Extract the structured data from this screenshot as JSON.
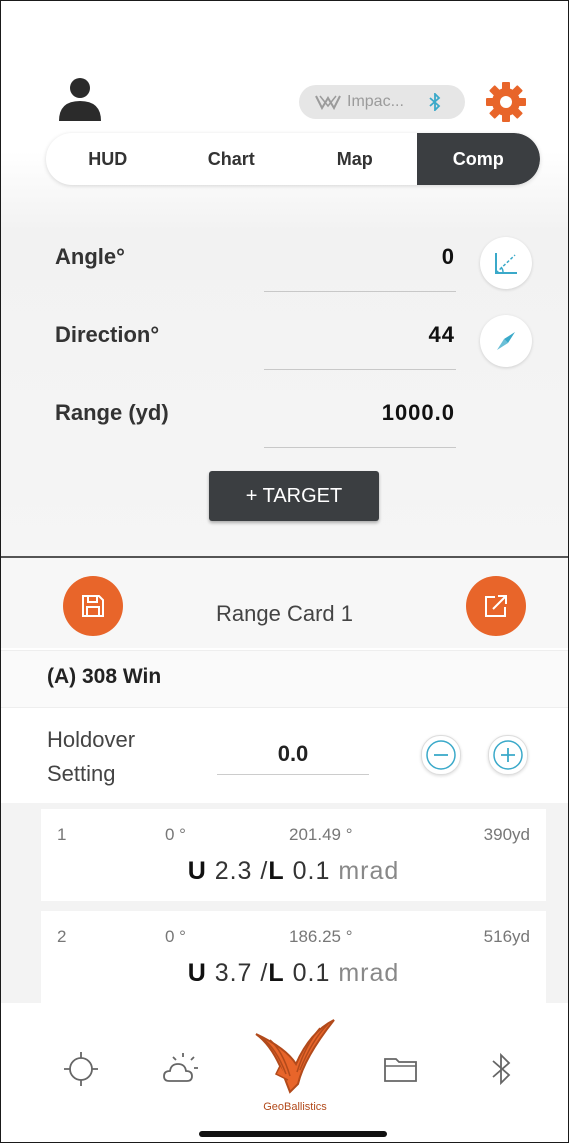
{
  "header": {
    "device_name": "Impac...",
    "tabs": [
      {
        "label": "HUD",
        "active": false
      },
      {
        "label": "Chart",
        "active": false
      },
      {
        "label": "Map",
        "active": false
      },
      {
        "label": "Comp",
        "active": true
      }
    ]
  },
  "fields": {
    "angle": {
      "label": "Angle°",
      "value": "0"
    },
    "direction": {
      "label": "Direction°",
      "value": "44"
    },
    "range": {
      "label": "Range (yd)",
      "value": "1000.0"
    }
  },
  "target_button": "+ TARGET",
  "range_card": {
    "title": "Range Card 1",
    "ammo": "(A) 308 Win",
    "holdover_label": "Holdover Setting",
    "holdover_value": "0.0"
  },
  "shots": [
    {
      "index": "1",
      "angle": "0 °",
      "direction": "201.49 °",
      "range": "390yd",
      "u_label": "U",
      "u_value": "2.3",
      "sep": "/",
      "l_label": "L",
      "l_value": "0.1",
      "unit": "mrad"
    },
    {
      "index": "2",
      "angle": "0 °",
      "direction": "186.25 °",
      "range": "516yd",
      "u_label": "U",
      "u_value": "3.7",
      "sep": "/",
      "l_label": "L",
      "l_value": "0.1",
      "unit": "mrad"
    }
  ],
  "brand": "GeoBallistics",
  "colors": {
    "accent": "#e8652a",
    "dark": "#3b3e41",
    "teal": "#3aa9c9"
  },
  "icons": {
    "avatar": "user-icon",
    "gear": "gear-icon",
    "bluetooth": "bluetooth-icon",
    "angle": "angle-icon",
    "compass": "compass-icon",
    "save": "save-icon",
    "export": "export-icon",
    "crosshair": "crosshair-icon",
    "weather": "weather-icon",
    "folder": "folder-icon"
  }
}
